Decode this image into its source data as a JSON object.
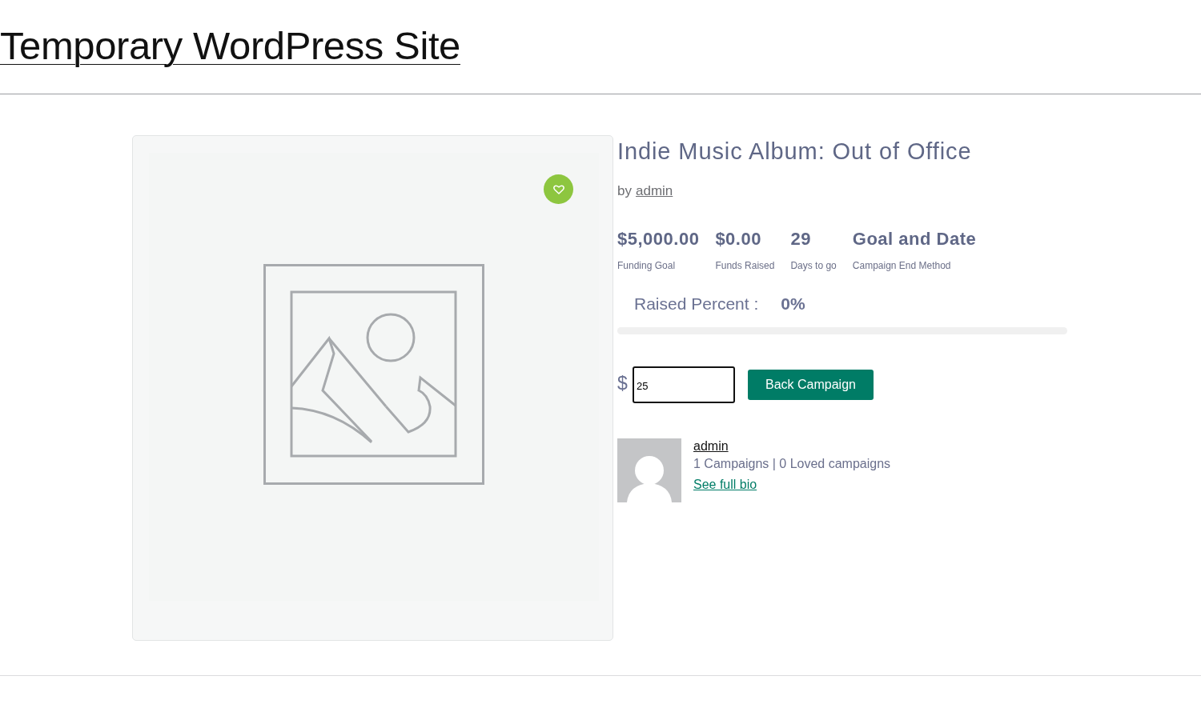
{
  "site": {
    "title": "Temporary WordPress Site"
  },
  "campaign": {
    "title": "Indie Music Album: Out of Office",
    "byline": {
      "prefix": "by",
      "author": "admin"
    },
    "stats": [
      {
        "value": "$5,000.00",
        "label": "Funding Goal"
      },
      {
        "value": "$0.00",
        "label": "Funds Raised"
      },
      {
        "value": "29",
        "label": "Days to go"
      },
      {
        "value": "Goal and Date",
        "label": "Campaign End Method"
      }
    ],
    "raised": {
      "label": "Raised Percent :",
      "value": "0%",
      "level": 0
    },
    "donation": {
      "currency": "$",
      "amount": "25",
      "button": "Back Campaign"
    },
    "author_box": {
      "name": "admin",
      "stats": "1 Campaigns | 0 Loved campaigns",
      "link": "See full bio"
    }
  }
}
